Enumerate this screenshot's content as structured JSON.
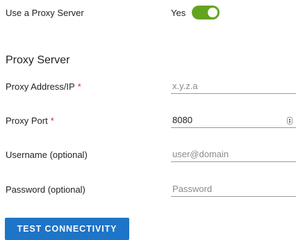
{
  "proxy_toggle": {
    "label": "Use a Proxy Server",
    "state_text": "Yes",
    "enabled": true
  },
  "section": {
    "title": "Proxy Server"
  },
  "fields": {
    "address": {
      "label": "Proxy Address/IP",
      "required_mark": "*",
      "value": "",
      "placeholder": "x.y.z.a"
    },
    "port": {
      "label": "Proxy Port",
      "required_mark": "*",
      "value": "8080",
      "placeholder": ""
    },
    "username": {
      "label": "Username (optional)",
      "value": "",
      "placeholder": "user@domain"
    },
    "password": {
      "label": "Password (optional)",
      "value": "",
      "placeholder": "Password"
    }
  },
  "actions": {
    "test_label": "TEST CONNECTIVITY"
  },
  "colors": {
    "toggle_on": "#62a420",
    "required": "#e02424",
    "button_bg": "#1e74c7"
  }
}
